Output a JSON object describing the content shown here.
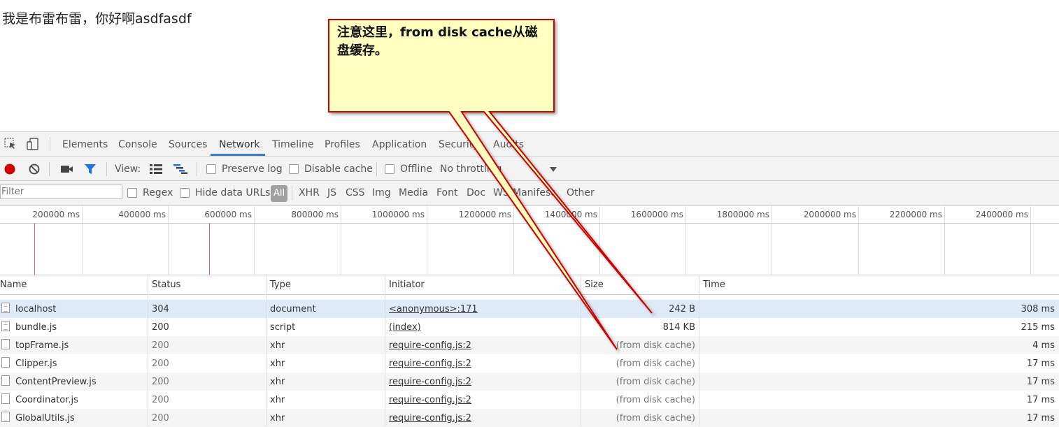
{
  "page": {
    "text": "我是布雷布雷，你好啊asdfasdf"
  },
  "devtools": {
    "tabs": [
      "Elements",
      "Console",
      "Sources",
      "Network",
      "Timeline",
      "Profiles",
      "Application",
      "Security",
      "Audits"
    ],
    "toolbar": {
      "view_label": "View:",
      "preserve_log": "Preserve log",
      "disable_cache": "Disable cache",
      "offline": "Offline",
      "throttling": "No throttling"
    },
    "filter": {
      "placeholder": "Filter",
      "regex": "Regex",
      "hide_data_urls": "Hide data URLs",
      "types": [
        "All",
        "XHR",
        "JS",
        "CSS",
        "Img",
        "Media",
        "Font",
        "Doc",
        "WS",
        "Manifest",
        "Other"
      ]
    },
    "timeline": {
      "ticks": [
        "200000 ms",
        "400000 ms",
        "600000 ms",
        "800000 ms",
        "1000000 ms",
        "1200000 ms",
        "1400000 ms",
        "1600000 ms",
        "1800000 ms",
        "2000000 ms",
        "2200000 ms",
        "2400000 ms"
      ]
    },
    "table": {
      "columns": [
        "Name",
        "Status",
        "Type",
        "Initiator",
        "Size",
        "Time"
      ],
      "rows": [
        {
          "name": "localhost",
          "status": "304",
          "type": "document",
          "initiator": "<anonymous>:171",
          "size": "242 B",
          "time": "308 ms"
        },
        {
          "name": "bundle.js",
          "status": "200",
          "type": "script",
          "initiator": "(index)",
          "size": "814 KB",
          "time": "215 ms"
        },
        {
          "name": "topFrame.js",
          "status": "200",
          "type": "xhr",
          "initiator": "require-config.js:2",
          "size": "(from disk cache)",
          "time": "4 ms"
        },
        {
          "name": "Clipper.js",
          "status": "200",
          "type": "xhr",
          "initiator": "require-config.js:2",
          "size": "(from disk cache)",
          "time": "17 ms"
        },
        {
          "name": "ContentPreview.js",
          "status": "200",
          "type": "xhr",
          "initiator": "require-config.js:2",
          "size": "(from disk cache)",
          "time": "17 ms"
        },
        {
          "name": "Coordinator.js",
          "status": "200",
          "type": "xhr",
          "initiator": "require-config.js:2",
          "size": "(from disk cache)",
          "time": "17 ms"
        },
        {
          "name": "GlobalUtils.js",
          "status": "200",
          "type": "xhr",
          "initiator": "require-config.js:2",
          "size": "(from disk cache)",
          "time": "17 ms"
        }
      ]
    }
  },
  "callout": {
    "text": "注意这里，from disk cache从磁盘缓存。",
    "fill": "#ffffc0",
    "border": "#cc0000"
  },
  "colors": {
    "record": "#d00000",
    "filter_icon": "#1a73e8",
    "accent": "#3879d9"
  }
}
